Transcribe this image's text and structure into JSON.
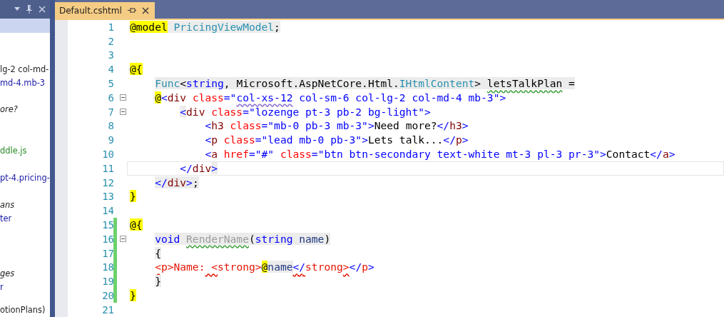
{
  "side_panel": {
    "groups": [
      [
        {
          "text": "lg-2 col-md-",
          "kind": "plain"
        },
        {
          "text": "md-4.mb-3",
          "kind": "link"
        }
      ],
      [
        {
          "text": "ore?",
          "kind": "italic"
        }
      ],
      [
        {
          "text": "ddle.js",
          "kind": "file"
        }
      ],
      [
        {
          "text": "pt-4.pricing-",
          "kind": "link"
        }
      ],
      [
        {
          "text": "ans",
          "kind": "italic"
        },
        {
          "text": "ter",
          "kind": "link"
        }
      ],
      [
        {
          "text": "ges",
          "kind": "italic"
        },
        {
          "text": "r",
          "kind": "link"
        }
      ],
      [
        {
          "text": "otionPlans)",
          "kind": "plain"
        }
      ]
    ]
  },
  "tabs": [
    {
      "title": "Default.cshtml",
      "selected": true
    }
  ],
  "editor": {
    "lines": [
      {
        "number": "1",
        "kind": "outer",
        "tokens": [
          {
            "text": "@model",
            "kind": "razor"
          },
          {
            "text": " PricingViewModel",
            "kind": "type",
            "shade": true
          },
          {
            "text": ";",
            "kind": "plain",
            "shade": true
          }
        ]
      },
      {
        "number": "2"
      },
      {
        "number": "3"
      },
      {
        "number": "4",
        "kind": "outer",
        "tokens": [
          {
            "text": "@{",
            "kind": "razor"
          }
        ]
      },
      {
        "number": "5",
        "kind": "inner",
        "tokens": [
          {
            "text": "Func",
            "kind": "type",
            "shade": true
          },
          {
            "text": "<",
            "kind": "plain",
            "shade": true
          },
          {
            "text": "string",
            "kind": "keyword",
            "shade": true
          },
          {
            "text": ", Microsoft.AspNetCore.Html.",
            "kind": "plain",
            "shade": true
          },
          {
            "text": "IHtmlContent",
            "kind": "type",
            "shade": true
          },
          {
            "text": "> ",
            "kind": "plain",
            "shade": true
          },
          {
            "text": "letsTalkPlan",
            "kind": "plain",
            "shade": true,
            "warning": true
          },
          {
            "text": " =",
            "kind": "plain",
            "shade": true
          }
        ]
      },
      {
        "number": "6",
        "kind": "inner",
        "fold": true,
        "tokens": [
          {
            "text": "@",
            "kind": "razor"
          },
          {
            "text": "<",
            "kind": "delim"
          },
          {
            "text": "div",
            "kind": "tag"
          },
          {
            "text": " class",
            "kind": "attr"
          },
          {
            "text": "=",
            "kind": "delim"
          },
          {
            "text": "\"",
            "kind": "string"
          },
          {
            "text": "col-xs-12",
            "kind": "string",
            "hint": true
          },
          {
            "text": " col-sm-6 col-lg-2 col-md-4 mb-3\"",
            "kind": "string"
          },
          {
            "text": ">",
            "kind": "delim"
          }
        ]
      },
      {
        "number": "7",
        "kind": "nested",
        "fold": true,
        "tokens": [
          {
            "text": "<",
            "kind": "delim",
            "shade": true
          },
          {
            "text": "div",
            "kind": "tag"
          },
          {
            "text": " class",
            "kind": "attr"
          },
          {
            "text": "=",
            "kind": "delim"
          },
          {
            "text": "\"lozenge pt-3 pb-2 bg-light\"",
            "kind": "string"
          },
          {
            "text": ">",
            "kind": "delim"
          }
        ]
      },
      {
        "number": "8",
        "kind": "deep",
        "tokens": [
          {
            "text": "<",
            "kind": "delim"
          },
          {
            "text": "h3",
            "kind": "tag"
          },
          {
            "text": " class",
            "kind": "attr"
          },
          {
            "text": "=",
            "kind": "delim"
          },
          {
            "text": "\"mb-0 pb-3 mb-3\"",
            "kind": "string"
          },
          {
            "text": ">",
            "kind": "delim"
          },
          {
            "text": "Need more?",
            "kind": "plain"
          },
          {
            "text": "</",
            "kind": "delim"
          },
          {
            "text": "h3",
            "kind": "tag"
          },
          {
            "text": ">",
            "kind": "delim"
          }
        ]
      },
      {
        "number": "9",
        "kind": "deep",
        "tokens": [
          {
            "text": "<",
            "kind": "delim"
          },
          {
            "text": "p",
            "kind": "tag"
          },
          {
            "text": " class",
            "kind": "attr"
          },
          {
            "text": "=",
            "kind": "delim"
          },
          {
            "text": "\"lead mb-0 pb-3\"",
            "kind": "string"
          },
          {
            "text": ">",
            "kind": "delim"
          },
          {
            "text": "Lets talk...",
            "kind": "plain"
          },
          {
            "text": "</",
            "kind": "delim"
          },
          {
            "text": "p",
            "kind": "tag"
          },
          {
            "text": ">",
            "kind": "delim"
          }
        ]
      },
      {
        "number": "10",
        "kind": "deep",
        "tokens": [
          {
            "text": "<",
            "kind": "delim"
          },
          {
            "text": "a",
            "kind": "tag"
          },
          {
            "text": " href",
            "kind": "attr"
          },
          {
            "text": "=",
            "kind": "delim"
          },
          {
            "text": "\"#\"",
            "kind": "string"
          },
          {
            "text": " class",
            "kind": "attr"
          },
          {
            "text": "=",
            "kind": "delim"
          },
          {
            "text": "\"btn btn-secondary text-white mt-3 pl-3 pr-3\"",
            "kind": "string"
          },
          {
            "text": ">",
            "kind": "delim"
          },
          {
            "text": "Contact",
            "kind": "plain"
          },
          {
            "text": "</",
            "kind": "delim"
          },
          {
            "text": "a",
            "kind": "tag"
          },
          {
            "text": ">",
            "kind": "delim"
          }
        ]
      },
      {
        "number": "11",
        "kind": "nested",
        "current": true,
        "tokens": [
          {
            "text": "</",
            "kind": "delim"
          },
          {
            "text": "div",
            "kind": "tag"
          },
          {
            "text": ">",
            "kind": "delim",
            "shade": true
          }
        ]
      },
      {
        "number": "12",
        "kind": "inner",
        "tokens": [
          {
            "text": "</",
            "kind": "delim",
            "shade": true
          },
          {
            "text": "div",
            "kind": "tag",
            "shade": true
          },
          {
            "text": ">",
            "kind": "delim",
            "shade": true
          },
          {
            "text": ";",
            "kind": "plain",
            "shade": true
          }
        ]
      },
      {
        "number": "13",
        "kind": "outer",
        "tokens": [
          {
            "text": "}",
            "kind": "razor"
          }
        ]
      },
      {
        "number": "14"
      },
      {
        "number": "15",
        "kind": "outer",
        "changed": true,
        "tokens": [
          {
            "text": "@{",
            "kind": "razor"
          }
        ]
      },
      {
        "number": "16",
        "kind": "inner",
        "changed": true,
        "fold": true,
        "tokens": [
          {
            "text": "void ",
            "kind": "keyword",
            "shade": true
          },
          {
            "text": "RenderName",
            "kind": "unused",
            "shade": true,
            "warning": true
          },
          {
            "text": "(",
            "kind": "plain",
            "shade": true
          },
          {
            "text": "string",
            "kind": "keyword",
            "shade": true
          },
          {
            "text": " name",
            "kind": "variable",
            "shade": true
          },
          {
            "text": ")",
            "kind": "plain",
            "shade": true
          }
        ]
      },
      {
        "number": "17",
        "kind": "inner",
        "changed": true,
        "tokens": [
          {
            "text": "{",
            "kind": "plain",
            "shade": true
          }
        ]
      },
      {
        "number": "18",
        "kind": "inner",
        "changed": true,
        "tokens": [
          {
            "text": "<",
            "kind": "error",
            "error": true
          },
          {
            "text": "p>Name:",
            "kind": "error"
          },
          {
            "text": " <",
            "kind": "error",
            "error": true
          },
          {
            "text": "strong>",
            "kind": "error"
          },
          {
            "text": "@",
            "kind": "razor"
          },
          {
            "text": "name",
            "kind": "variable",
            "shade": true
          },
          {
            "text": "</",
            "kind": "delim",
            "error": true
          },
          {
            "text": "strong",
            "kind": "error"
          },
          {
            "text": ">",
            "kind": "error",
            "error": true
          },
          {
            "text": "</",
            "kind": "delim"
          },
          {
            "text": "p",
            "kind": "error"
          },
          {
            "text": ">",
            "kind": "delim"
          }
        ]
      },
      {
        "number": "19",
        "kind": "inner",
        "changed": true,
        "tokens": [
          {
            "text": "}",
            "kind": "plain",
            "shade": true
          }
        ]
      },
      {
        "number": "20",
        "kind": "outer",
        "changed": true,
        "tokens": [
          {
            "text": "}",
            "kind": "razor"
          }
        ]
      },
      {
        "number": "21"
      }
    ]
  }
}
